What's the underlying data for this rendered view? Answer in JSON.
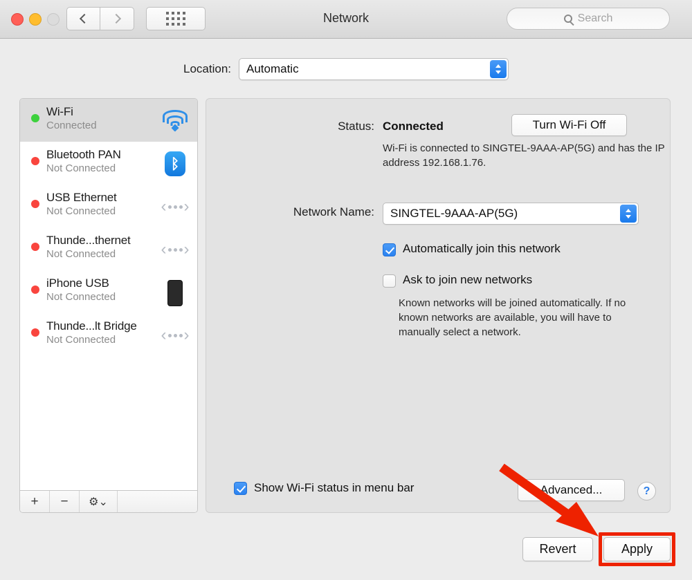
{
  "window": {
    "title": "Network",
    "traffic_lights": [
      "close-red",
      "minimize-yellow",
      "zoom-gray-disabled"
    ],
    "nav": {
      "back": "‹",
      "forward": "›"
    },
    "grid_button": "show-all-icon",
    "search": {
      "placeholder": "Search",
      "value": ""
    }
  },
  "location": {
    "label": "Location:",
    "value": "Automatic",
    "options": [
      "Automatic"
    ]
  },
  "sidebar": {
    "items": [
      {
        "name": "Wi-Fi",
        "status": "Connected",
        "dot": "green",
        "icon": "wifi-icon",
        "selected": true
      },
      {
        "name": "Bluetooth PAN",
        "status": "Not Connected",
        "dot": "red",
        "icon": "bluetooth-icon",
        "selected": false
      },
      {
        "name": "USB Ethernet",
        "status": "Not Connected",
        "dot": "red",
        "icon": "ethernet-icon",
        "selected": false
      },
      {
        "name": "Thunde...thernet",
        "status": "Not Connected",
        "dot": "red",
        "icon": "ethernet-icon",
        "selected": false
      },
      {
        "name": "iPhone USB",
        "status": "Not Connected",
        "dot": "red",
        "icon": "iphone-icon",
        "selected": false
      },
      {
        "name": "Thunde...lt Bridge",
        "status": "Not Connected",
        "dot": "red",
        "icon": "ethernet-icon",
        "selected": false
      }
    ],
    "footer": {
      "add": "+",
      "remove": "−",
      "actions": "⚙"
    }
  },
  "panel": {
    "status_label": "Status:",
    "status_value": "Connected",
    "turn_off_button": "Turn Wi-Fi Off",
    "status_description": "Wi-Fi is connected to SINGTEL-9AAA-AP(5G) and has the IP address 192.168.1.76.",
    "network_name_label": "Network Name:",
    "network_name_value": "SINGTEL-9AAA-AP(5G)",
    "auto_join": {
      "label": "Automatically join this network",
      "checked": true
    },
    "ask_join": {
      "label": "Ask to join new networks",
      "checked": false
    },
    "help_text": "Known networks will be joined automatically. If no known networks are available, you will have to manually select a network.",
    "show_status_menu_bar": {
      "label": "Show Wi-Fi status in menu bar",
      "checked": true
    },
    "advanced_button": "Advanced...",
    "help_button": "?"
  },
  "actions": {
    "revert": "Revert",
    "apply": "Apply"
  },
  "annotation": {
    "arrow_color": "#ee2200",
    "highlight_color": "#ee2200",
    "highlight_target": "Apply"
  }
}
